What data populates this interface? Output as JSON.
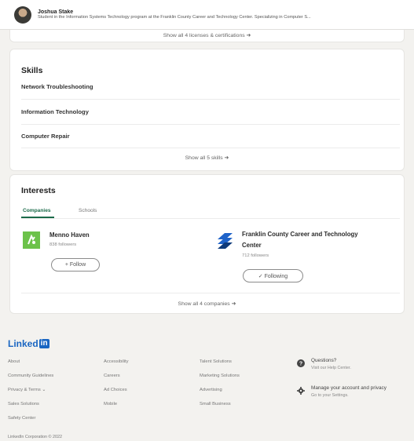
{
  "topbar": {
    "name": "Joshua Stake",
    "headline": "Student in the Information Systems Technology program at the Franklin County Career and Technology Center. Specializing in Computer S..."
  },
  "licenses": {
    "show_all": "Show all 4 licenses & certifications"
  },
  "skills": {
    "title": "Skills",
    "items": [
      "Network Troubleshooting",
      "Information Technology",
      "Computer Repair"
    ],
    "show_all": "Show all 5 skills"
  },
  "interests": {
    "title": "Interests",
    "tabs": [
      "Companies",
      "Schools"
    ],
    "active_tab": "Companies",
    "companies": [
      {
        "name_line1": "Menno Haven",
        "name_line2": "",
        "followers": "838 followers",
        "button": "+ Follow",
        "logo": "menno-haven-logo",
        "logo_color": "#6cc24a"
      },
      {
        "name_line1": "Franklin County Career and Technology",
        "name_line2": "Center",
        "followers": "712 followers",
        "button": "✓ Following",
        "logo": "franklin-county-ctc-logo",
        "logo_color": "#1f63c9"
      }
    ],
    "show_all": "Show all 4 companies"
  },
  "footer": {
    "brand": "Linked",
    "brand_in": "in",
    "col1": [
      "About",
      "Community Guidelines",
      "Privacy & Terms ⌄",
      "Sales Solutions",
      "Safety Center"
    ],
    "col2": [
      "Accessibility",
      "Careers",
      "Ad Choices",
      "Mobile"
    ],
    "col3": [
      "Talent Solutions",
      "Marketing Solutions",
      "Advertising",
      "Small Business"
    ],
    "help": {
      "questions_title": "Questions?",
      "questions_sub": "Visit our Help Center.",
      "manage_title": "Manage your account and privacy",
      "manage_sub": "Go to your Settings."
    },
    "copyright": "LinkedIn Corporation © 2022"
  },
  "colors": {
    "accent_green": "#1b6b4a",
    "linkedin_blue": "#1a66c2"
  }
}
